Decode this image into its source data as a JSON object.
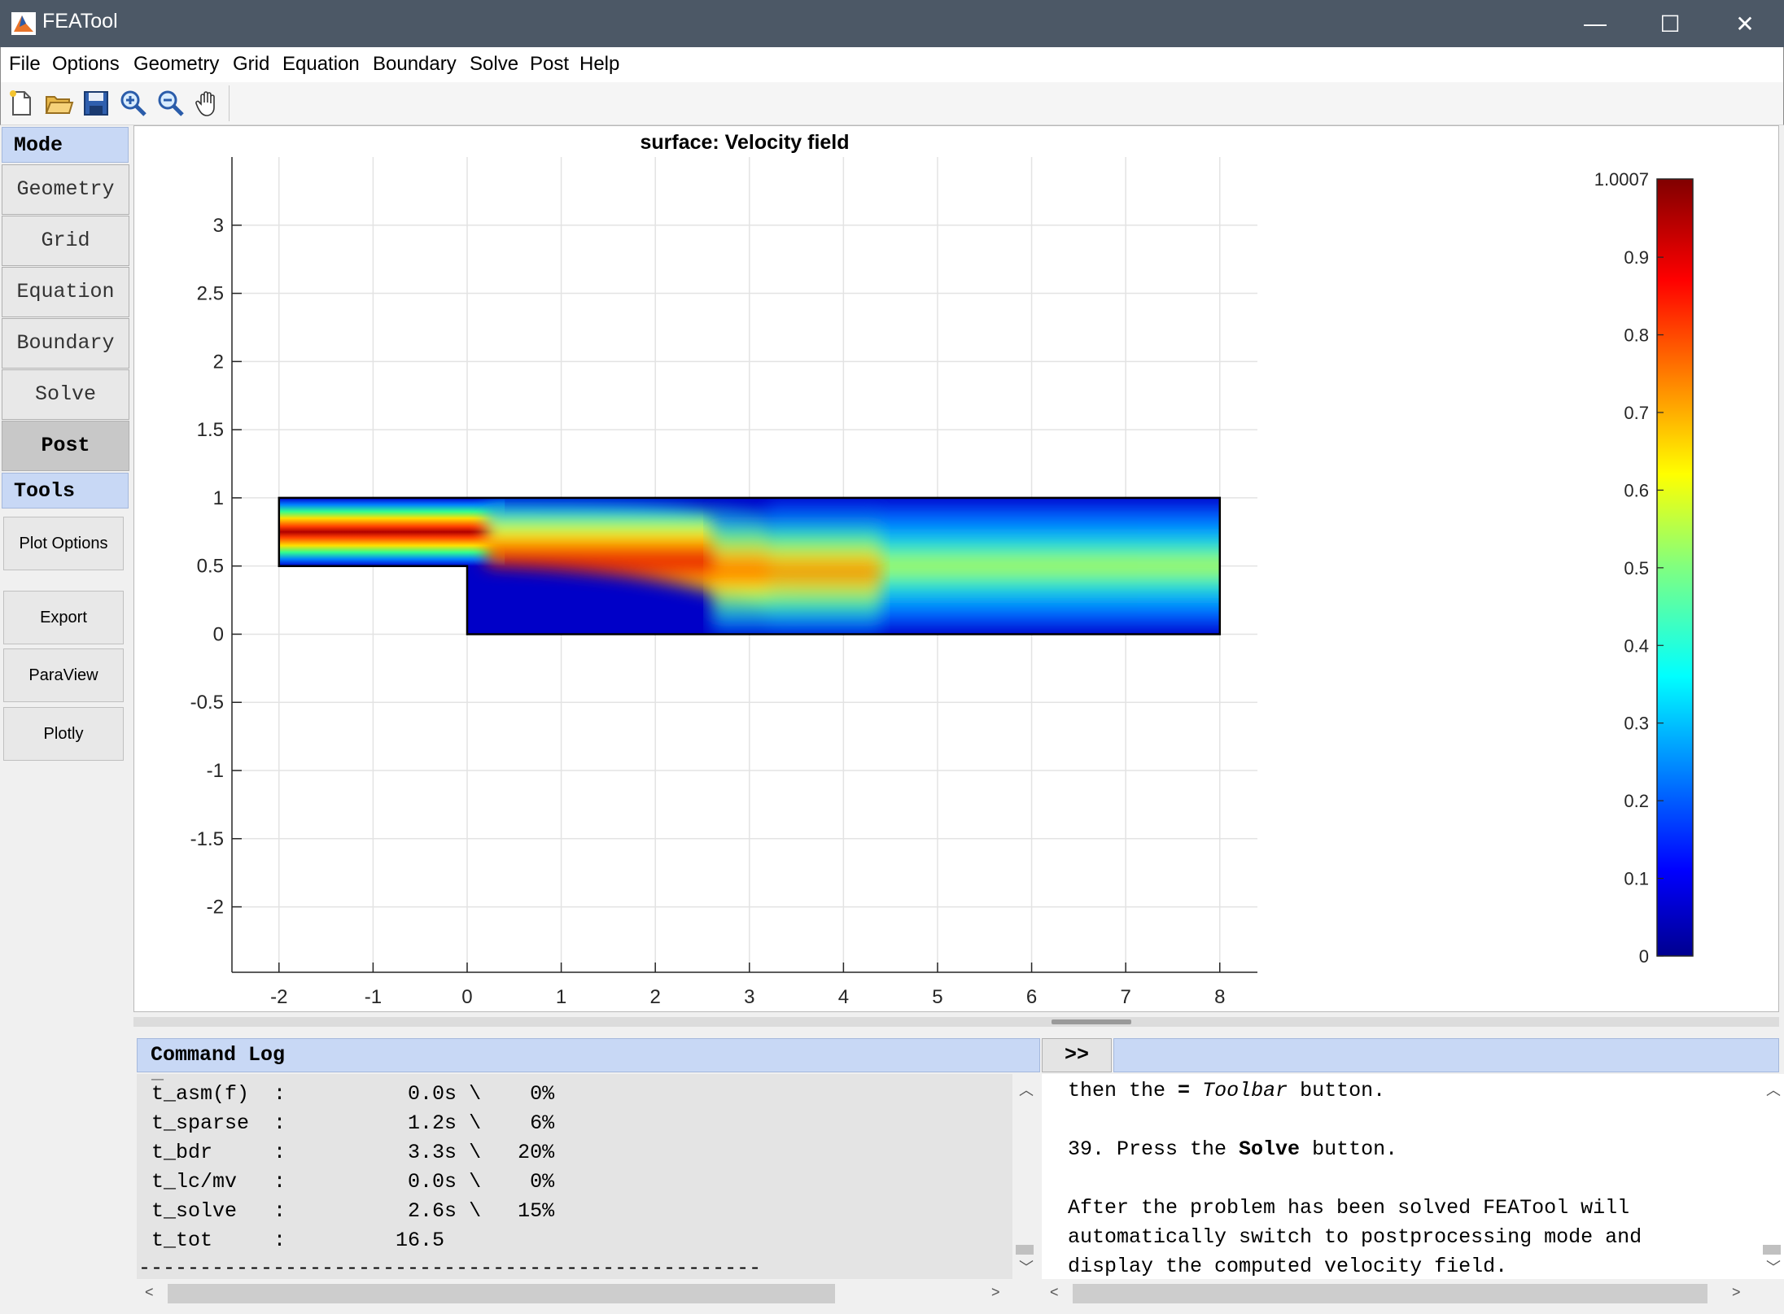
{
  "window": {
    "title": "FEATool",
    "minimize": "—",
    "maximize": "☐",
    "close": "✕"
  },
  "menu": [
    "File",
    "Options",
    "Geometry",
    "Grid",
    "Equation",
    "Boundary",
    "Solve",
    "Post",
    "Help"
  ],
  "toolbar": {
    "icons": [
      "new-file-icon",
      "open-folder-icon",
      "save-icon",
      "zoom-in-icon",
      "zoom-out-icon",
      "pan-hand-icon"
    ]
  },
  "sidebar": {
    "mode_label": "Mode",
    "modes": [
      "Geometry",
      "Grid",
      "Equation",
      "Boundary",
      "Solve",
      "Post"
    ],
    "active_mode": "Post",
    "tools_label": "Tools",
    "tools": [
      "Plot Options",
      "Export",
      "ParaView",
      "Plotly"
    ]
  },
  "chart_data": {
    "type": "heatmap",
    "title": "surface: Velocity field",
    "xlabel": "",
    "ylabel": "",
    "xlim": [
      -2.5,
      8.4
    ],
    "ylim": [
      -2.48,
      3.5
    ],
    "xticks": [
      -2,
      -1,
      0,
      1,
      2,
      3,
      4,
      5,
      6,
      7,
      8
    ],
    "yticks": [
      3,
      2.5,
      2,
      1.5,
      1,
      0.5,
      0,
      -0.5,
      -1,
      -1.5,
      -2
    ],
    "grid": true,
    "colormap": "jet",
    "colorbar": {
      "min": 0,
      "max": 1.0007,
      "max_label": "1.0007",
      "ticks": [
        0.9,
        0.8,
        0.7,
        0.6,
        0.5,
        0.4,
        0.3,
        0.2,
        0.1,
        0
      ]
    },
    "domain_polygon": [
      [
        -2,
        0.5
      ],
      [
        -2,
        1
      ],
      [
        8,
        1
      ],
      [
        8,
        0
      ],
      [
        0,
        0
      ],
      [
        0,
        0.5
      ]
    ]
  },
  "log": {
    "title": "Command Log",
    "lines": [
      "t_asm(f)  :          0.0s \\    0%",
      "t_sparse  :          1.2s \\    6%",
      "t_bdr     :          3.3s \\   20%",
      "t_lc/mv   :          0.0s \\    0%",
      "t_solve   :          2.6s \\   15%",
      "t_tot     :         16.5",
      "---------------------------------------------------"
    ]
  },
  "expand_label": ">>",
  "help": {
    "l1_pre": "then the ",
    "l1_sym": "=",
    "l1_mid": " ",
    "l1_it": "Toolbar",
    "l1_post": " button.",
    "l2_pre": "39. Press the ",
    "l2_bold": "Solve",
    "l2_post": " button.",
    "l3": "After the problem has been solved FEATool will",
    "l4": "automatically switch to postprocessing mode and",
    "l5": "display the computed velocity field."
  },
  "colors": {
    "titlebar": "#4c5866",
    "header_bg": "#c8d8f5",
    "domain_edge": "#000000"
  }
}
